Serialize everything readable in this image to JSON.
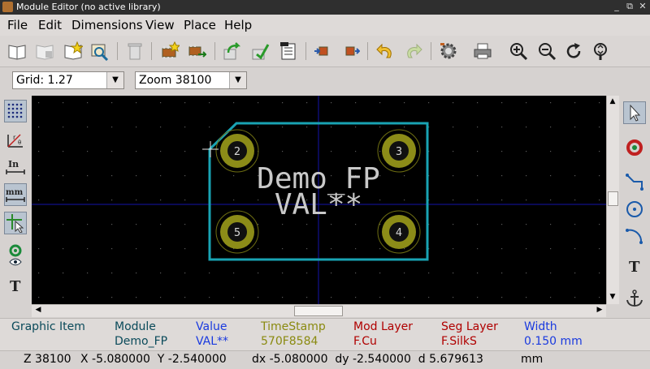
{
  "window": {
    "title": "Module Editor (no active library)",
    "app_icon": "kicad-icon"
  },
  "menu": [
    "File",
    "Edit",
    "Dimensions",
    "View",
    "Place",
    "Help"
  ],
  "toolbar_icons": [
    "select-library-icon",
    "save-library-icon",
    "new-library-icon",
    "load-module-icon",
    "delete-module-icon",
    "new-module-icon",
    "module-wizard-icon",
    "import-module-icon",
    "export-module-icon",
    "module-properties-icon",
    "insert-module-icon",
    "update-module-icon",
    "undo-icon",
    "redo-icon",
    "pad-settings-icon",
    "print-icon",
    "zoom-in-icon",
    "zoom-out-icon",
    "redraw-icon",
    "zoom-fit-icon"
  ],
  "selectors": {
    "grid": "Grid: 1.27",
    "zoom": "Zoom 38100"
  },
  "left_toolbar_icons": [
    "grid-toggle-icon",
    "polar-coords-icon",
    "inch-units-icon",
    "mm-units-icon",
    "cursor-shape-icon",
    "show-pads-icon",
    "text-sketch-icon"
  ],
  "right_toolbar_icons": [
    "select-arrow-icon",
    "add-pad-icon",
    "add-line-icon",
    "add-circle-icon",
    "add-arc-icon",
    "add-text-icon",
    "anchor-icon"
  ],
  "footprint": {
    "reference": "Demo_FP",
    "value": "VAL**",
    "pads": [
      "2",
      "3",
      "5",
      "4"
    ]
  },
  "colors": {
    "outline": "#19a3b3",
    "pad": "#8c8c18",
    "text": "#c9c9c9",
    "axis": "#1414aa",
    "background": "#000000"
  },
  "message_panel": [
    {
      "label": "Graphic Item",
      "value": "",
      "color": "#0a4a5a"
    },
    {
      "label": "Module",
      "value": "Demo_FP",
      "color": "#0a4a5a"
    },
    {
      "label": "Value",
      "value": "VAL**",
      "color": "#1a3adf"
    },
    {
      "label": "TimeStamp",
      "value": "570F8584",
      "color": "#8a8a10"
    },
    {
      "label": "Mod Layer",
      "value": "F.Cu",
      "color": "#b00000"
    },
    {
      "label": "Seg Layer",
      "value": "F.SilkS",
      "color": "#b00000"
    },
    {
      "label": "Width",
      "value": "0.150 mm",
      "color": "#1a3adf"
    }
  ],
  "status": {
    "zoom": "Z 38100",
    "xy": "X -5.080000  Y -2.540000",
    "dxy": "dx -5.080000  dy -2.540000  d 5.679613",
    "units": "mm"
  }
}
